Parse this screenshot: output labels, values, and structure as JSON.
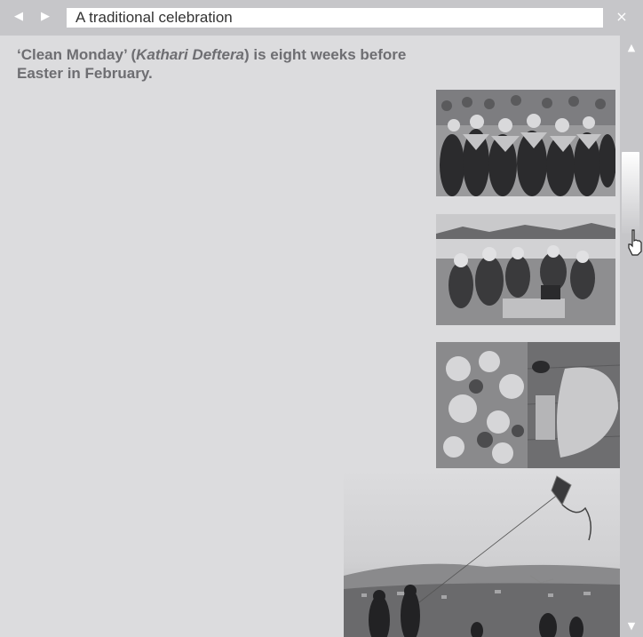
{
  "window": {
    "title": "A traditional celebration",
    "back_icon": "◀",
    "forward_icon": "▶",
    "close_icon": "×"
  },
  "main": {
    "intro_part1": "‘Clean Monday’ (",
    "intro_italic": "Kathari Deftera",
    "intro_part2": ") is eight weeks before Easter in February."
  },
  "scrollbar": {
    "up_icon": "▲",
    "down_icon": "▼"
  },
  "colors": {
    "window_bg": "#dcdcde",
    "chrome": "#c6c6c9",
    "text": "#6e6e72"
  },
  "images": [
    {
      "name": "dancers-photo",
      "subject": "women in traditional costume dancing"
    },
    {
      "name": "picnic-photo",
      "subject": "family picnic by the sea"
    },
    {
      "name": "food-photo",
      "subject": "lenten food and lagana bread"
    },
    {
      "name": "kite-photo",
      "subject": "kite flying on a hill above the city"
    }
  ]
}
